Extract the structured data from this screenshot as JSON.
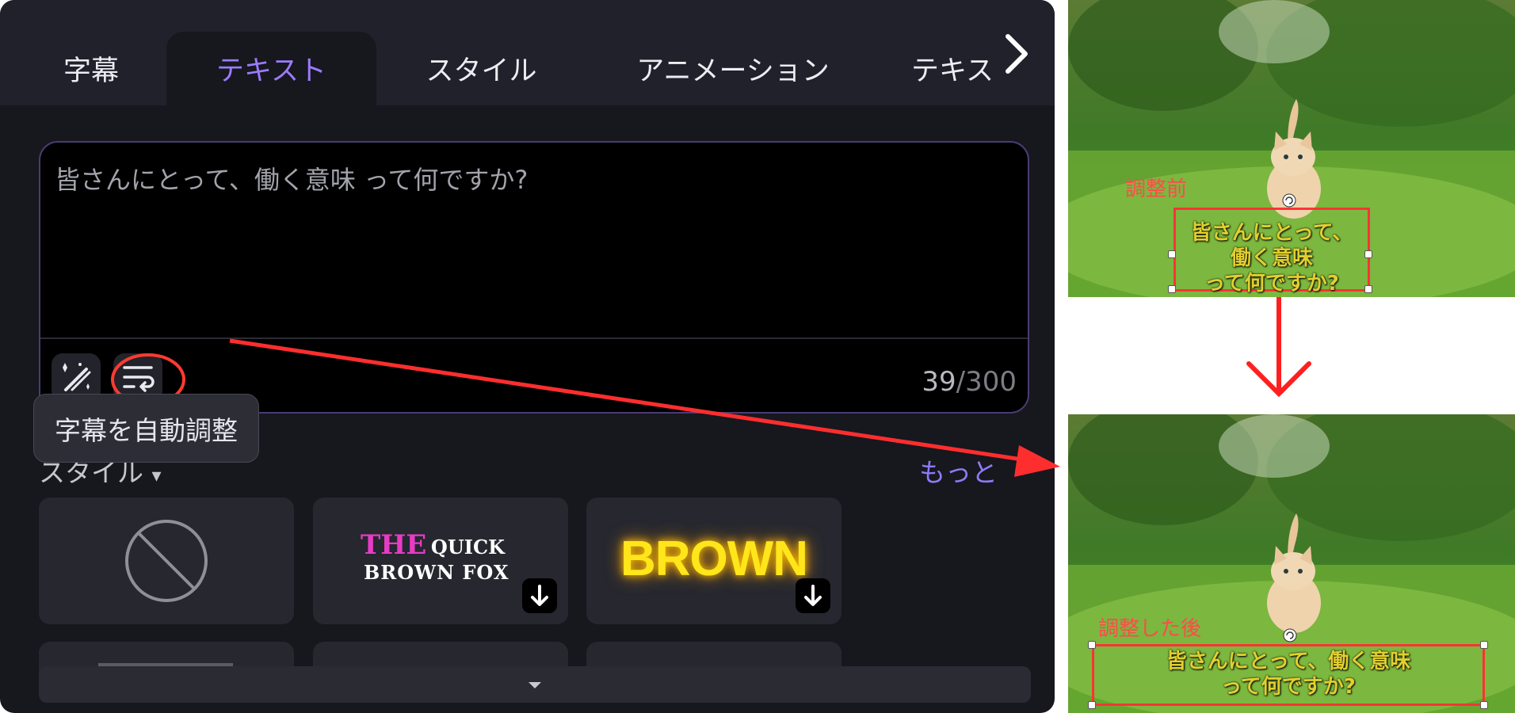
{
  "tabs": [
    "字幕",
    "テキスト",
    "スタイル",
    "アニメーション",
    "テキス"
  ],
  "textbox": {
    "text": "皆さんにとって、働く意味 って何ですか?",
    "count": "39",
    "max": "/300"
  },
  "tooltip": "字幕を自動調整",
  "styles": {
    "label": "スタイル",
    "more": "もっと",
    "card2_line1_a": "THE",
    "card2_line1_b": "QUICK",
    "card2_line2": "BROWN FOX",
    "card3": "BROWN"
  },
  "preview": {
    "before_label": "調整前",
    "after_label": "調整した後",
    "before_lines": [
      "皆さんにとって、",
      "働く意味",
      "って何ですか?"
    ],
    "after_lines": [
      "皆さんにとって、働く意味",
      "って何ですか?"
    ]
  },
  "colors": {
    "accent": "#9b7bff",
    "annotation_red": "#ff3333",
    "subtitle_yellow": "#e1cf2f",
    "card2_pink": "#e63cc4",
    "card3_yellow": "#ffe61a"
  },
  "icons": {
    "tab_next": "chevron-right-icon",
    "magic": "magic-wand-icon",
    "autofit": "text-wrap-icon",
    "none_style": "no-style-icon",
    "download": "download-icon",
    "dropdown": "caret-down-icon"
  }
}
